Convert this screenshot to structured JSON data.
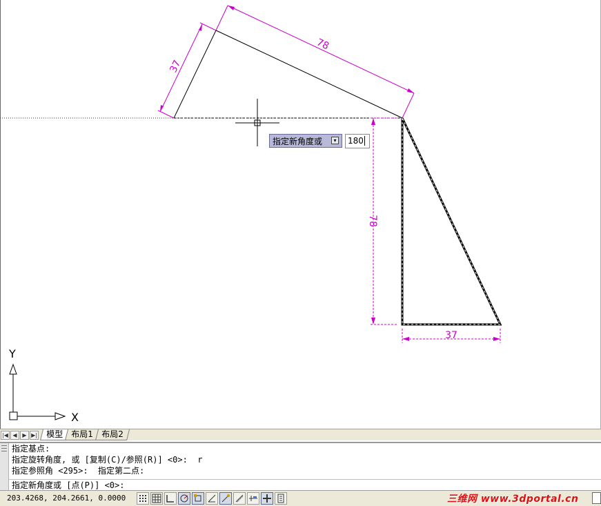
{
  "drawing": {
    "dim_top": "78",
    "dim_left": "37",
    "dim_vertical": "78",
    "dim_bottom": "37",
    "ucs_y": "Y",
    "ucs_x": "X"
  },
  "dynamic_input": {
    "prompt": "指定新角度或",
    "value": "180"
  },
  "tabs": [
    "模型",
    "布局1",
    "布局2"
  ],
  "command": {
    "history": [
      "指定基点:",
      "指定旋转角度, 或 [复制(C)/参照(R)] <0>:  r",
      "指定参照角 <295>:  指定第二点:"
    ],
    "current": "指定新角度或 [点(P)] <0>:"
  },
  "status": {
    "coordinates": "203.4268, 204.2661, 0.0000",
    "watermark": "三维网 www.3dportal.cn"
  },
  "colors": {
    "dimension": "#cc00cc",
    "geometry": "#000000"
  }
}
